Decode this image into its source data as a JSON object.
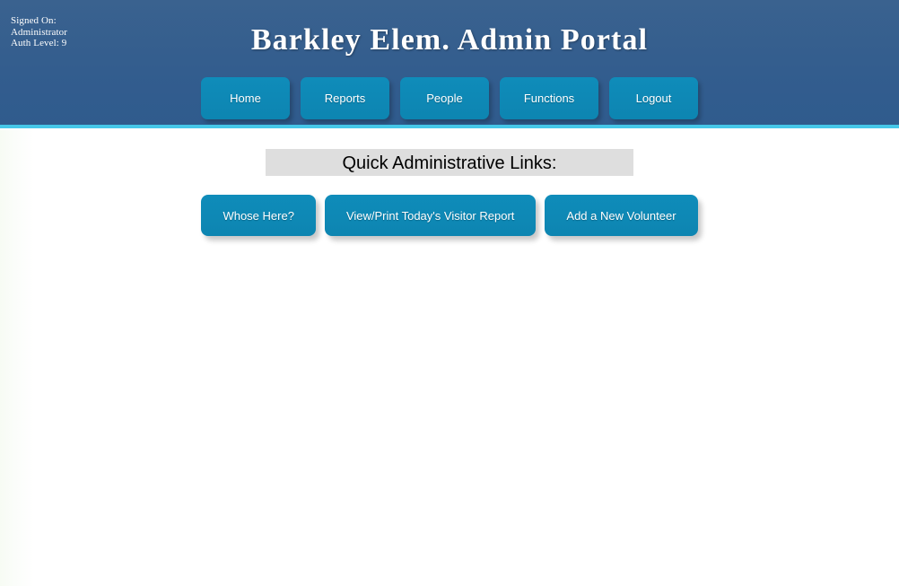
{
  "header": {
    "title": "Barkley Elem. Admin Portal",
    "signed_on": {
      "label": "Signed On:",
      "user": "Administrator",
      "auth_level": "Auth Level: 9"
    },
    "nav": [
      {
        "label": "Home",
        "name": "nav-home"
      },
      {
        "label": "Reports",
        "name": "nav-reports"
      },
      {
        "label": "People",
        "name": "nav-people"
      },
      {
        "label": "Functions",
        "name": "nav-functions"
      },
      {
        "label": "Logout",
        "name": "nav-logout"
      }
    ],
    "colors": {
      "background": "#335d8f",
      "accent_line": "#45c7e8",
      "button": "#0e88b5",
      "text": "#ffffff"
    }
  },
  "main": {
    "section_heading": "Quick Administrative Links:",
    "quick_links": [
      {
        "label": "Whose Here?",
        "name": "quick-link-whose-here"
      },
      {
        "label": "View/Print Today's Visitor Report",
        "name": "quick-link-visitor-report"
      },
      {
        "label": "Add a New Volunteer",
        "name": "quick-link-add-volunteer"
      }
    ],
    "colors": {
      "heading_background": "#dedede",
      "heading_text": "#000000",
      "button": "#0e88b5"
    }
  }
}
